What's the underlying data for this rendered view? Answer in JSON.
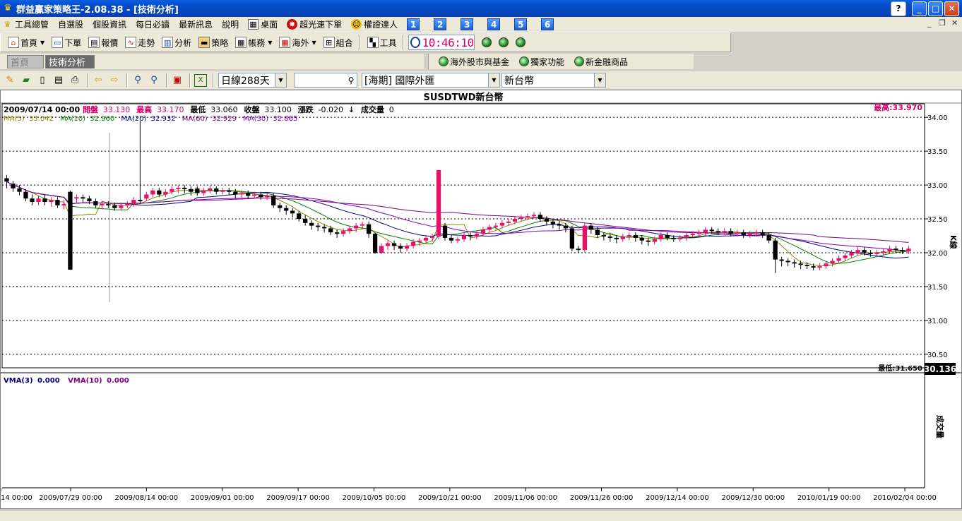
{
  "window": {
    "title": "群益贏家策略王-2.08.38 - [技術分析]",
    "help": "?",
    "minimize": "_",
    "maximize": "□",
    "close": "✕"
  },
  "menu": {
    "items": [
      "工具總管",
      "自選股",
      "個股資訊",
      "每日必讀",
      "最新訊息",
      "說明",
      "桌面",
      "超光速下單",
      "權證達人"
    ],
    "numbers": [
      "1",
      "2",
      "3",
      "4",
      "5",
      "6"
    ],
    "mdi": [
      "_",
      "❐",
      "✕"
    ]
  },
  "toolbar1": {
    "items": [
      "首頁",
      "下單",
      "報價",
      "走勢",
      "分析",
      "策略",
      "帳務",
      "海外",
      "組合",
      "工具"
    ],
    "clock": "10:46:10"
  },
  "tabs": {
    "home": "首頁",
    "ta": "技術分析"
  },
  "extlinks": [
    "海外股市與基金",
    "獨家功能",
    "新金融商品"
  ],
  "toolbar2": {
    "period": "日線288天",
    "search_value": "",
    "market": "[海期] 國際外匯",
    "currency": "新台幣"
  },
  "chart_data": {
    "type": "candlestick",
    "title": "SUSDTWD新台幣",
    "info": {
      "date": "2009/07/14 00:00",
      "open_label": "開盤",
      "open": "33.130",
      "high_label": "最高",
      "high": "33.170",
      "low_label": "最低",
      "low": "33.060",
      "close_label": "收盤",
      "close": "33.100",
      "change_label": "漲跌",
      "change": "-0.020",
      "change_arrow": "↓",
      "vol_label": "成交量",
      "vol": "0"
    },
    "ma": [
      {
        "label": "MA(5)",
        "value": "33.042",
        "color": "#8b8b00"
      },
      {
        "label": "MA(10)",
        "value": "32.960",
        "color": "#008000"
      },
      {
        "label": "MA(20)",
        "value": "32.932",
        "color": "#000080"
      },
      {
        "label": "MA(60)",
        "value": "32.929",
        "color": "#800080"
      },
      {
        "label": "MA(30)",
        "value": "32.865",
        "color": "#8000c0"
      }
    ],
    "max_label": "最高:33.970",
    "min_label": "最低:31.650",
    "current_value": "30.136",
    "y_ticks": [
      "34.00",
      "33.50",
      "33.00",
      "32.50",
      "32.00",
      "31.50",
      "31.00",
      "30.50"
    ],
    "y_side_label": "K線",
    "vol_side_label": "成交量",
    "vma": [
      {
        "label": "VMA(3)",
        "value": "0.000",
        "color": "#000080"
      },
      {
        "label": "VMA(10)",
        "value": "0.000",
        "color": "#800080"
      }
    ],
    "x_ticks": [
      "14 00:00",
      "2009/07/29 00:00",
      "2009/08/14 00:00",
      "2009/09/01 00:00",
      "2009/09/17 00:00",
      "2009/10/05 00:00",
      "2009/10/21 00:00",
      "2009/11/06 00:00",
      "2009/11/26 00:00",
      "2009/12/14 00:00",
      "2009/12/30 00:00",
      "2010/01/19 00:00",
      "2010/02/04 00:00"
    ],
    "ylim": [
      30.3,
      34.2
    ],
    "candles": [
      [
        33.1,
        33.05,
        33.15,
        32.95
      ],
      [
        33.02,
        32.95,
        33.06,
        32.9
      ],
      [
        32.95,
        32.9,
        33.0,
        32.85
      ],
      [
        32.9,
        32.8,
        32.94,
        32.76
      ],
      [
        32.8,
        32.75,
        32.86,
        32.7
      ],
      [
        32.75,
        32.8,
        32.84,
        32.7
      ],
      [
        32.8,
        32.75,
        32.86,
        32.7
      ],
      [
        32.75,
        32.78,
        32.82,
        32.68
      ],
      [
        32.78,
        32.7,
        32.82,
        32.66
      ],
      [
        32.7,
        32.72,
        32.78,
        32.64
      ],
      [
        32.9,
        31.75,
        32.92,
        31.75
      ],
      [
        32.8,
        32.82,
        32.86,
        32.74
      ],
      [
        32.82,
        32.8,
        32.86,
        32.74
      ],
      [
        32.8,
        32.76,
        32.84,
        32.72
      ],
      [
        32.76,
        32.7,
        32.8,
        32.66
      ],
      [
        32.7,
        32.72,
        32.76,
        32.64
      ],
      [
        32.72,
        32.7,
        32.76,
        32.66
      ],
      [
        32.7,
        32.66,
        32.74,
        32.62
      ],
      [
        32.66,
        32.7,
        32.74,
        32.62
      ],
      [
        32.7,
        32.72,
        32.76,
        32.66
      ],
      [
        32.72,
        32.78,
        32.82,
        32.68
      ],
      [
        32.78,
        32.76,
        33.95,
        32.72
      ],
      [
        32.8,
        32.86,
        32.9,
        32.76
      ],
      [
        32.86,
        32.92,
        32.96,
        32.82
      ],
      [
        32.92,
        32.86,
        32.96,
        32.82
      ],
      [
        32.86,
        32.9,
        32.94,
        32.82
      ],
      [
        32.9,
        32.94,
        32.98,
        32.86
      ],
      [
        32.94,
        32.96,
        33.0,
        32.88
      ],
      [
        32.96,
        32.94,
        33.0,
        32.88
      ],
      [
        32.94,
        32.9,
        32.98,
        32.84
      ],
      [
        32.95,
        32.88,
        32.98,
        32.84
      ],
      [
        32.88,
        32.92,
        32.96,
        32.84
      ],
      [
        32.92,
        32.95,
        32.99,
        32.88
      ],
      [
        32.95,
        32.9,
        32.98,
        32.86
      ],
      [
        32.9,
        32.92,
        32.96,
        32.86
      ],
      [
        32.92,
        32.9,
        32.96,
        32.86
      ],
      [
        32.9,
        32.86,
        32.94,
        32.8
      ],
      [
        32.86,
        32.88,
        32.92,
        32.8
      ],
      [
        32.88,
        32.84,
        32.92,
        32.8
      ],
      [
        32.84,
        32.86,
        32.9,
        32.8
      ],
      [
        32.86,
        32.82,
        32.9,
        32.78
      ],
      [
        32.82,
        32.84,
        32.88,
        32.78
      ],
      [
        32.84,
        32.7,
        32.88,
        32.66
      ],
      [
        32.7,
        32.66,
        32.74,
        32.6
      ],
      [
        32.66,
        32.62,
        32.7,
        32.56
      ],
      [
        32.62,
        32.58,
        32.66,
        32.52
      ],
      [
        32.58,
        32.5,
        32.62,
        32.46
      ],
      [
        32.5,
        32.44,
        32.56,
        32.4
      ],
      [
        32.44,
        32.4,
        32.48,
        32.34
      ],
      [
        32.4,
        32.38,
        32.44,
        32.32
      ],
      [
        32.38,
        32.36,
        32.42,
        32.3
      ],
      [
        32.36,
        32.3,
        32.4,
        32.26
      ],
      [
        32.3,
        32.28,
        32.34,
        32.22
      ],
      [
        32.28,
        32.32,
        32.36,
        32.24
      ],
      [
        32.32,
        32.36,
        32.4,
        32.28
      ],
      [
        32.36,
        32.4,
        32.44,
        32.3
      ],
      [
        32.4,
        32.42,
        32.46,
        32.34
      ],
      [
        32.42,
        32.28,
        32.46,
        32.22
      ],
      [
        32.28,
        32.0,
        32.3,
        31.98
      ],
      [
        32.0,
        32.1,
        32.14,
        31.98
      ],
      [
        32.1,
        32.14,
        32.18,
        32.04
      ],
      [
        32.14,
        32.1,
        32.18,
        32.04
      ],
      [
        32.1,
        32.06,
        32.14,
        32.0
      ],
      [
        32.06,
        32.1,
        32.14,
        32.02
      ],
      [
        32.1,
        32.16,
        32.2,
        32.06
      ],
      [
        32.16,
        32.18,
        32.22,
        32.1
      ],
      [
        32.18,
        32.22,
        32.26,
        32.14
      ],
      [
        32.22,
        32.24,
        32.28,
        32.16
      ],
      [
        32.24,
        33.22,
        33.22,
        32.2
      ],
      [
        32.4,
        32.22,
        32.44,
        32.18
      ],
      [
        32.22,
        32.18,
        32.26,
        32.14
      ],
      [
        32.18,
        32.2,
        32.24,
        32.14
      ],
      [
        32.2,
        32.26,
        32.3,
        32.16
      ],
      [
        32.26,
        32.24,
        32.3,
        32.18
      ],
      [
        32.24,
        32.28,
        32.32,
        32.2
      ],
      [
        32.28,
        32.34,
        32.38,
        32.24
      ],
      [
        32.34,
        32.38,
        32.42,
        32.3
      ],
      [
        32.38,
        32.4,
        32.44,
        32.34
      ],
      [
        32.4,
        32.44,
        32.48,
        32.36
      ],
      [
        32.44,
        32.46,
        32.5,
        32.4
      ],
      [
        32.46,
        32.5,
        32.54,
        32.42
      ],
      [
        32.5,
        32.52,
        32.56,
        32.46
      ],
      [
        32.52,
        32.54,
        32.58,
        32.48
      ],
      [
        32.54,
        32.56,
        32.6,
        32.5
      ],
      [
        32.56,
        32.5,
        32.6,
        32.46
      ],
      [
        32.5,
        32.46,
        32.54,
        32.4
      ],
      [
        32.46,
        32.42,
        32.5,
        32.36
      ],
      [
        32.42,
        32.4,
        32.46,
        32.34
      ],
      [
        32.4,
        32.36,
        32.44,
        32.3
      ],
      [
        32.36,
        32.06,
        32.4,
        32.02
      ],
      [
        32.06,
        32.04,
        32.1,
        32.0
      ],
      [
        32.04,
        32.4,
        32.44,
        32.0
      ],
      [
        32.4,
        32.34,
        32.44,
        32.28
      ],
      [
        32.34,
        32.26,
        32.38,
        32.22
      ],
      [
        32.26,
        32.24,
        32.3,
        32.18
      ],
      [
        32.24,
        32.22,
        32.28,
        32.16
      ],
      [
        32.22,
        32.2,
        32.26,
        32.14
      ],
      [
        32.2,
        32.24,
        32.28,
        32.16
      ],
      [
        32.24,
        32.26,
        32.3,
        32.18
      ],
      [
        32.26,
        32.22,
        32.3,
        32.16
      ],
      [
        32.22,
        32.18,
        32.26,
        32.12
      ],
      [
        32.18,
        32.16,
        32.22,
        32.1
      ],
      [
        32.16,
        32.2,
        32.24,
        32.12
      ],
      [
        32.2,
        32.26,
        32.3,
        32.16
      ],
      [
        32.26,
        32.22,
        32.3,
        32.18
      ],
      [
        32.22,
        32.2,
        32.26,
        32.16
      ],
      [
        32.2,
        32.22,
        32.26,
        32.16
      ],
      [
        32.22,
        32.26,
        32.3,
        32.18
      ],
      [
        32.26,
        32.28,
        32.32,
        32.22
      ],
      [
        32.28,
        32.3,
        32.34,
        32.24
      ],
      [
        32.3,
        32.34,
        32.38,
        32.26
      ],
      [
        32.34,
        32.32,
        32.38,
        32.28
      ],
      [
        32.32,
        32.3,
        32.36,
        32.26
      ],
      [
        32.3,
        32.32,
        32.36,
        32.26
      ],
      [
        32.32,
        32.28,
        32.36,
        32.24
      ],
      [
        32.28,
        32.3,
        32.34,
        32.24
      ],
      [
        32.3,
        32.26,
        32.34,
        32.22
      ],
      [
        32.26,
        32.28,
        32.32,
        32.22
      ],
      [
        32.28,
        32.3,
        32.34,
        32.24
      ],
      [
        32.3,
        32.26,
        32.34,
        32.22
      ],
      [
        32.26,
        32.18,
        32.3,
        32.14
      ],
      [
        32.18,
        31.9,
        32.22,
        31.7
      ],
      [
        31.9,
        31.88,
        31.94,
        31.8
      ],
      [
        31.88,
        31.86,
        31.92,
        31.8
      ],
      [
        31.86,
        31.84,
        31.9,
        31.78
      ],
      [
        31.84,
        31.82,
        31.88,
        31.76
      ],
      [
        31.82,
        31.8,
        31.86,
        31.76
      ],
      [
        31.8,
        31.78,
        31.84,
        31.74
      ],
      [
        31.78,
        31.8,
        31.84,
        31.74
      ],
      [
        31.8,
        31.84,
        31.88,
        31.76
      ],
      [
        31.84,
        31.88,
        31.92,
        31.8
      ],
      [
        31.88,
        31.92,
        31.96,
        31.84
      ],
      [
        31.92,
        31.96,
        32.0,
        31.88
      ],
      [
        31.96,
        32.0,
        32.04,
        31.92
      ],
      [
        32.0,
        32.04,
        32.1,
        31.96
      ],
      [
        32.04,
        32.0,
        32.08,
        31.96
      ],
      [
        32.0,
        31.98,
        32.04,
        31.94
      ],
      [
        31.98,
        32.0,
        32.04,
        31.94
      ],
      [
        32.0,
        32.02,
        32.06,
        31.96
      ],
      [
        32.02,
        32.06,
        32.1,
        31.98
      ],
      [
        32.06,
        32.04,
        32.1,
        32.0
      ],
      [
        32.04,
        32.02,
        32.08,
        31.98
      ],
      [
        32.02,
        32.06,
        32.1,
        31.98
      ]
    ]
  }
}
